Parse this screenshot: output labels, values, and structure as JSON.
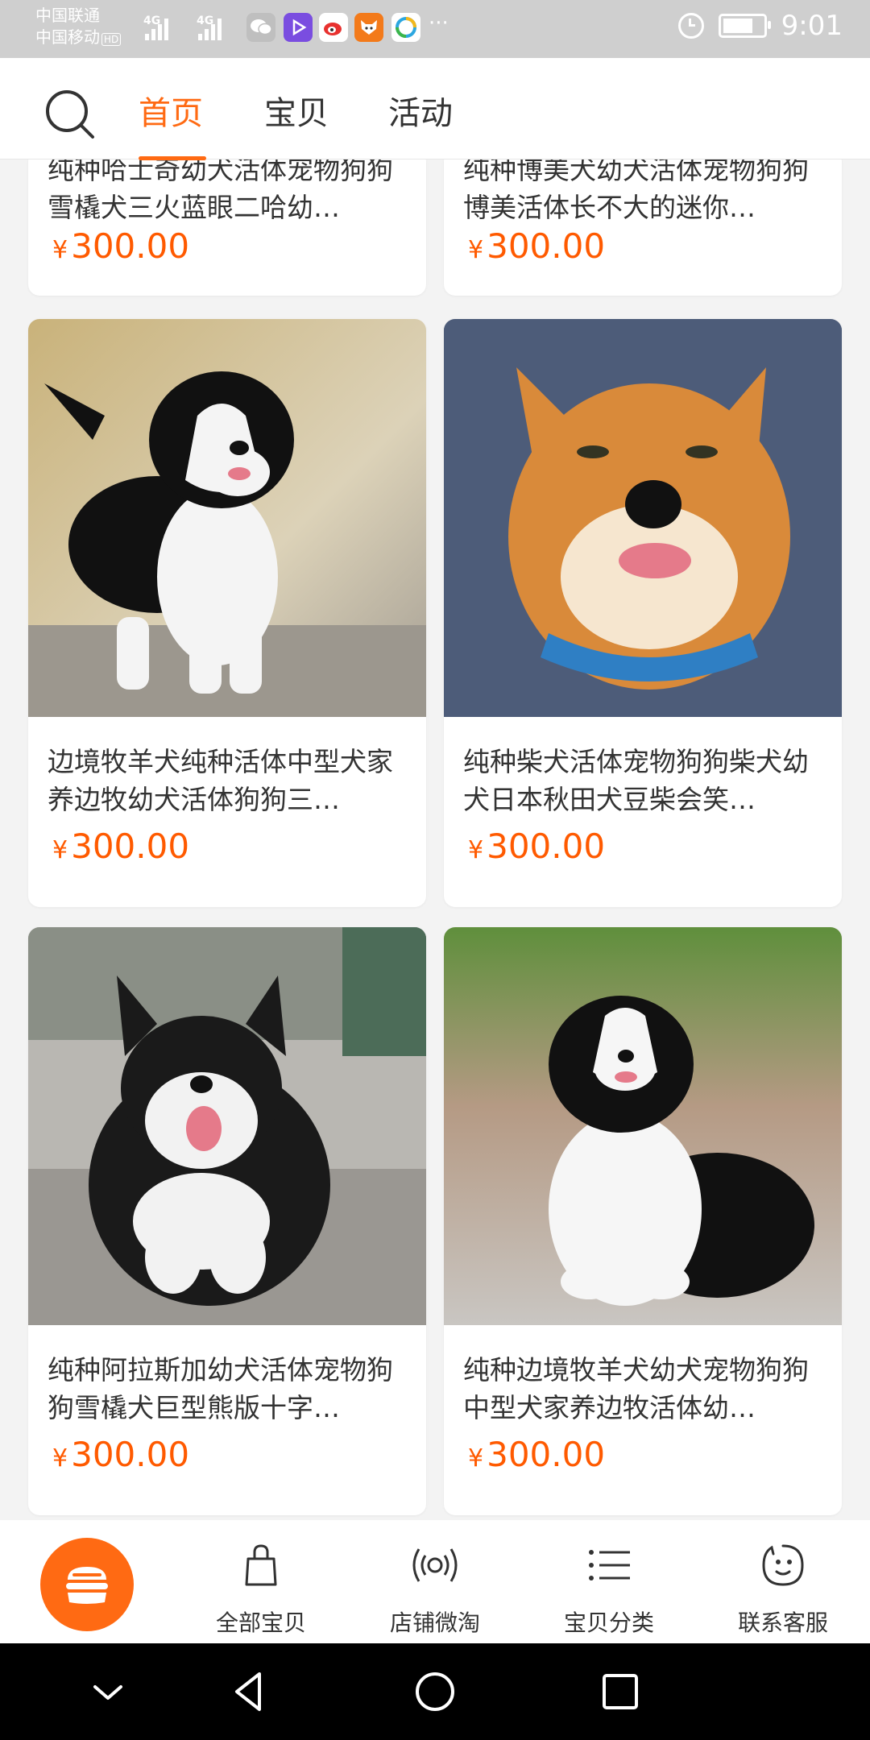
{
  "status_bar": {
    "carrier_1": "中国联通",
    "carrier_2": "中国移动",
    "hd_badge": "HD",
    "network_1": "4G",
    "network_2": "4G",
    "more": "···",
    "time": "9:01"
  },
  "header": {
    "tabs": [
      {
        "label": "首页",
        "active": true
      },
      {
        "label": "宝贝",
        "active": false
      },
      {
        "label": "活动",
        "active": false
      }
    ]
  },
  "products": [
    {
      "title": "纯种哈士奇幼犬活体宠物狗狗雪橇犬三火蓝眼二哈幼…",
      "currency": "¥",
      "price": "300.00"
    },
    {
      "title": "纯种博美犬幼犬活体宠物狗狗博美活体长不大的迷你…",
      "currency": "¥",
      "price": "300.00"
    },
    {
      "title": "边境牧羊犬纯种活体中型犬家养边牧幼犬活体狗狗三…",
      "currency": "¥",
      "price": "300.00"
    },
    {
      "title": "纯种柴犬活体宠物狗狗柴犬幼犬日本秋田犬豆柴会笑…",
      "currency": "¥",
      "price": "300.00"
    },
    {
      "title": "纯种阿拉斯加幼犬活体宠物狗狗雪橇犬巨型熊版十字…",
      "currency": "¥",
      "price": "300.00"
    },
    {
      "title": "纯种边境牧羊犬幼犬宠物狗狗中型犬家养边牧活体幼…",
      "currency": "¥",
      "price": "300.00"
    }
  ],
  "bottom_nav": {
    "items": [
      {
        "label": "全部宝贝",
        "icon": "shopping-bag-icon"
      },
      {
        "label": "店铺微淘",
        "icon": "broadcast-icon"
      },
      {
        "label": "宝贝分类",
        "icon": "list-icon"
      },
      {
        "label": "联系客服",
        "icon": "chat-face-icon"
      }
    ]
  },
  "colors": {
    "accent": "#ff6a13",
    "price": "#ff5a00"
  }
}
